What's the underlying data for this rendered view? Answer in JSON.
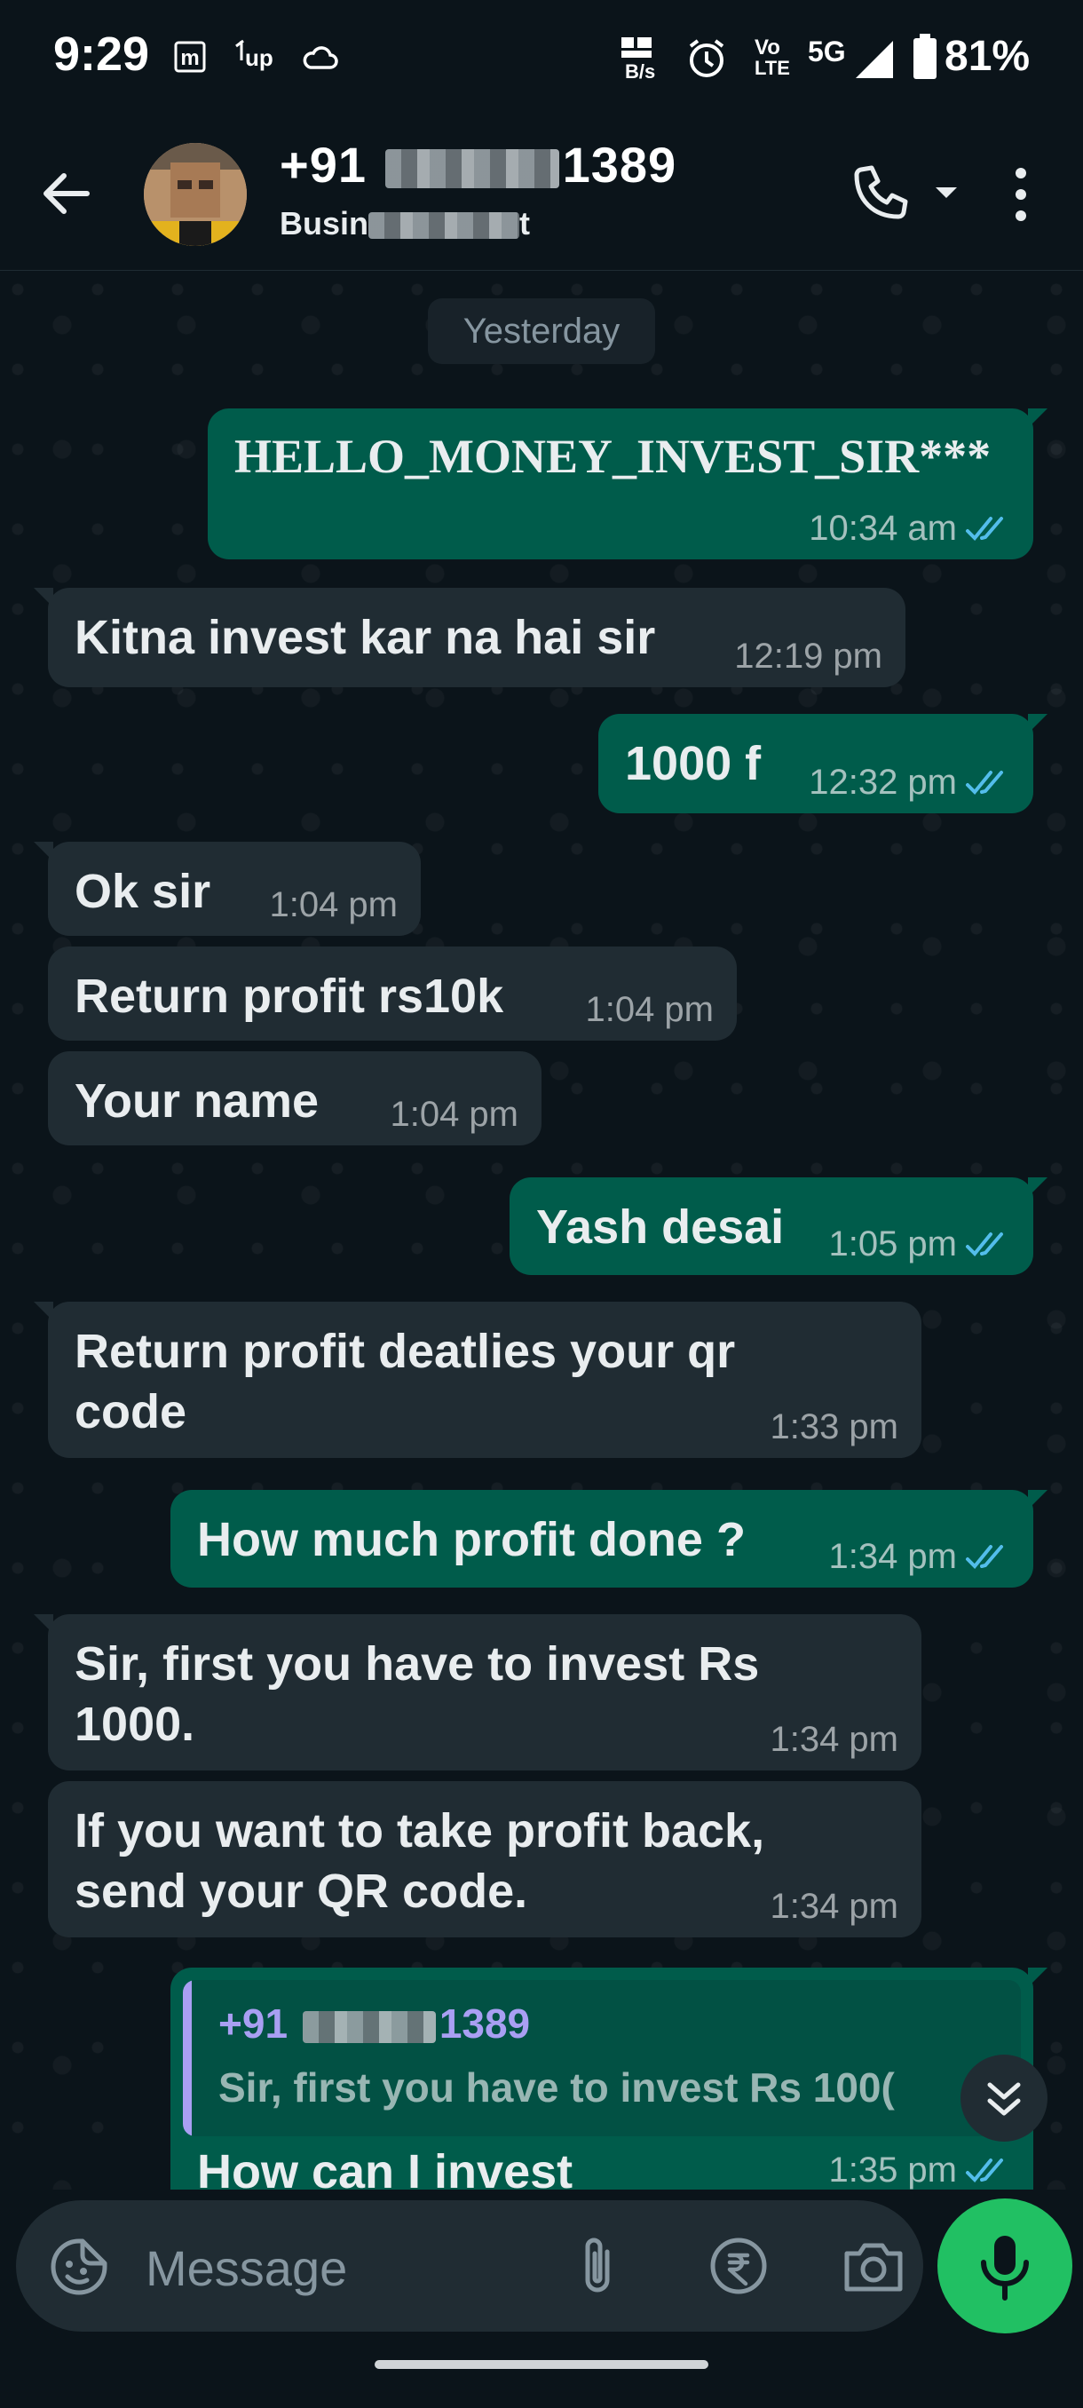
{
  "status_bar": {
    "time": "9:29",
    "icons": [
      "m-icon",
      "up-icon",
      "cloud-icon",
      "data-rate-icon",
      "alarm-icon",
      "volte-icon",
      "5g-icon",
      "signal-icon",
      "battery-icon"
    ],
    "net_rate": "B/s",
    "network": "5G",
    "volte_top": "Vo",
    "volte_bottom": "LTE",
    "battery": "81%"
  },
  "header": {
    "name_prefix": "+91",
    "name_suffix": "1389",
    "subtitle_prefix": "Busin",
    "subtitle_suffix": "t"
  },
  "chat": {
    "date_separator": "Yesterday",
    "messages": [
      {
        "dir": "out",
        "text": "HELLO_MONEY_INVEST_SIR***",
        "time": "10:34 am"
      },
      {
        "dir": "in",
        "text": "Kitna invest kar na hai sir",
        "time": "12:19 pm"
      },
      {
        "dir": "out",
        "text": "1000 f",
        "time": "12:32 pm"
      },
      {
        "dir": "in",
        "text": "Ok sir",
        "time": "1:04 pm"
      },
      {
        "dir": "in",
        "text": "Return profit rs10k",
        "time": "1:04 pm"
      },
      {
        "dir": "in",
        "text": "Your name",
        "time": "1:04 pm"
      },
      {
        "dir": "out",
        "text": "Yash desai",
        "time": "1:05 pm"
      },
      {
        "dir": "in",
        "text_lines": [
          "Return profit deatlies your qr",
          "code"
        ],
        "time": "1:33 pm"
      },
      {
        "dir": "out",
        "text": "How much profit done ?",
        "time": "1:34 pm"
      },
      {
        "dir": "in",
        "text_lines": [
          "Sir, first you have to invest Rs",
          "1000."
        ],
        "time": "1:34 pm"
      },
      {
        "dir": "in",
        "text_lines": [
          "If you want to take profit back,",
          "send your QR code."
        ],
        "time": "1:34 pm"
      },
      {
        "dir": "out",
        "quote_name_prefix": "+91",
        "quote_name_suffix": "1389",
        "quote_text": "Sir, first you have to invest Rs 100(",
        "text": "How can I invest",
        "time": "1:35 pm"
      }
    ]
  },
  "composer": {
    "placeholder": "Message"
  },
  "colors": {
    "background": "#0b141a",
    "incoming": "#202c33",
    "outgoing": "#005c4b",
    "accent": "#21c063",
    "read_ticks": "#53bdeb"
  }
}
